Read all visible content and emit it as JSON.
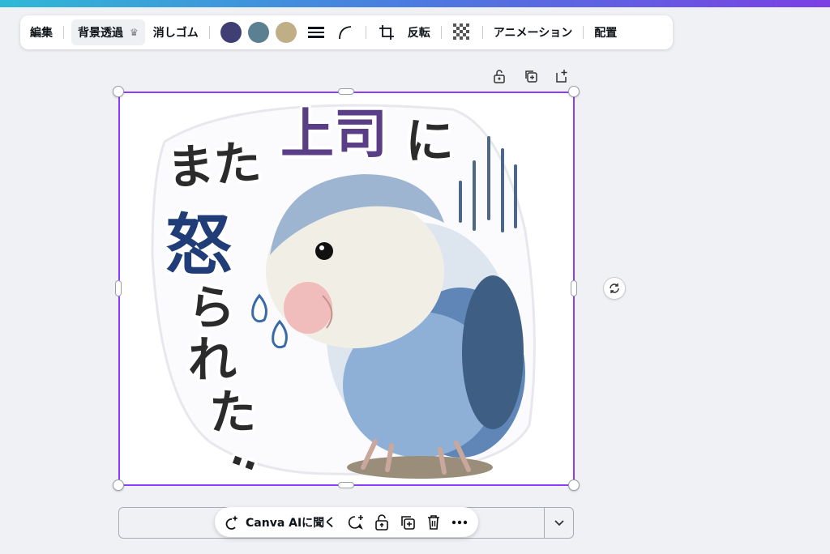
{
  "toolbar": {
    "edit_label": "編集",
    "bg_remove_label": "背景透過",
    "eraser_label": "消しゴム",
    "flip_label": "反転",
    "animate_label": "アニメーション",
    "position_label": "配置",
    "swatches": [
      "#3f3f73",
      "#5a8092",
      "#bfae86"
    ]
  },
  "sticker": {
    "text_mata": "また",
    "text_joushi": "上司",
    "text_ni": "に",
    "text_okora": "怒",
    "text_ra": "ら",
    "text_re": "れ",
    "text_ta": "た",
    "text_dots": "‥",
    "color_dark": "#2b2b2b",
    "color_purple": "#5b3f86",
    "color_navy": "#213d78"
  },
  "context_menu": {
    "ai_label": "Canva AIに聞く"
  },
  "colors": {
    "selection": "#8b3dff"
  }
}
